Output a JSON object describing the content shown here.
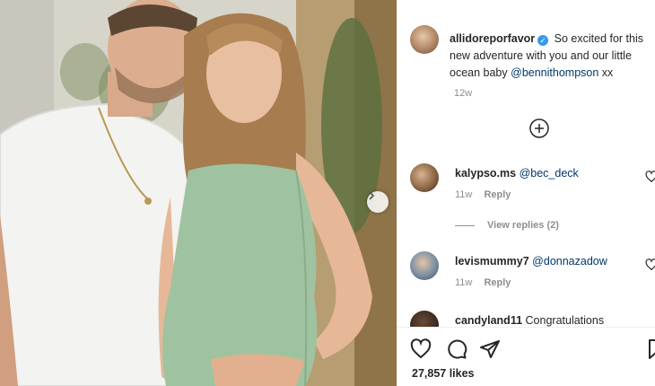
{
  "post": {
    "username": "allidoreporfavor",
    "caption_text": "So excited for this new adventure with you and our little ocean baby",
    "caption_mention": "@bennithompson",
    "caption_suffix": "xx",
    "time": "12w",
    "likes": "27,857 likes"
  },
  "comments": [
    {
      "username": "kalypso.ms",
      "text": "@bec_deck",
      "time": "11w",
      "reply": "Reply"
    },
    {
      "username": "levismummy7",
      "text": "@donnazadow",
      "time": "11w",
      "reply": "Reply"
    },
    {
      "username": "candyland11",
      "text": "Congratulations"
    }
  ],
  "view_replies": "View replies (2)",
  "icons": {
    "verified": "verified-badge-icon",
    "load_more": "plus-circle-icon",
    "next": "chevron-right-icon",
    "like": "heart-icon",
    "comment": "comment-bubble-icon",
    "share": "paper-plane-icon",
    "save": "bookmark-icon"
  },
  "colors": {
    "accent_blue": "#3897f0",
    "mention": "#00376b",
    "muted": "#8e8e8e",
    "dress": "#9fc3a0"
  }
}
